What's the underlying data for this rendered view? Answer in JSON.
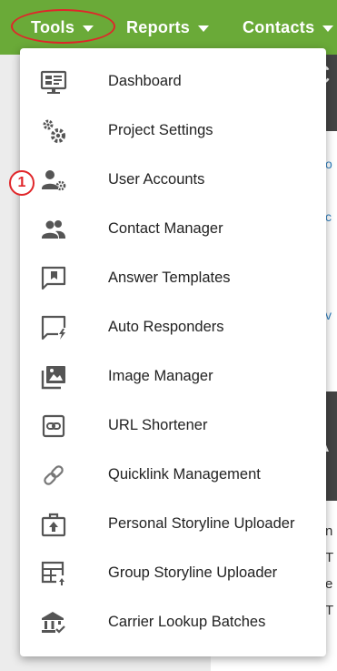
{
  "nav": {
    "tools": "Tools",
    "reports": "Reports",
    "contacts": "Contacts"
  },
  "menu": {
    "items": [
      {
        "label": "Dashboard",
        "icon": "dashboard-icon"
      },
      {
        "label": "Project Settings",
        "icon": "gears-icon"
      },
      {
        "label": "User Accounts",
        "icon": "user-settings-icon"
      },
      {
        "label": "Contact Manager",
        "icon": "people-icon"
      },
      {
        "label": "Answer Templates",
        "icon": "bookmark-chat-icon"
      },
      {
        "label": "Auto Responders",
        "icon": "chat-lightning-icon"
      },
      {
        "label": "Image Manager",
        "icon": "images-icon"
      },
      {
        "label": "URL Shortener",
        "icon": "link-box-icon"
      },
      {
        "label": "Quicklink Management",
        "icon": "link-icon"
      },
      {
        "label": "Personal Storyline Uploader",
        "icon": "upload-briefcase-icon"
      },
      {
        "label": "Group Storyline Uploader",
        "icon": "table-upload-icon"
      },
      {
        "label": "Carrier Lookup Batches",
        "icon": "bank-check-icon"
      }
    ]
  },
  "annotation": {
    "badge": "1"
  },
  "colors": {
    "nav_bg": "#6aaa38",
    "icon": "#555555",
    "annotation": "#e0262a",
    "link": "#2f7fbf"
  }
}
